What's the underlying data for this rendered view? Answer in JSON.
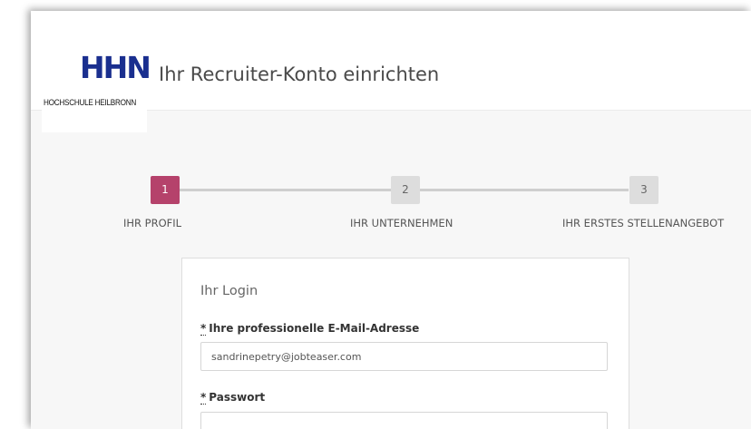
{
  "header": {
    "logo_mark": "HHN",
    "logo_text": "HOCHSCHULE HEILBRONN",
    "title": "Ihr Recruiter-Konto einrichten"
  },
  "stepper": {
    "steps": [
      {
        "number": "1",
        "label": "IHR PROFIL",
        "state": "active"
      },
      {
        "number": "2",
        "label": "IHR UNTERNEHMEN",
        "state": "inactive"
      },
      {
        "number": "3",
        "label": "IHR ERSTES STELLENANGEBOT",
        "state": "inactive"
      }
    ]
  },
  "form": {
    "section_title": "Ihr Login",
    "required_marker": "*",
    "email": {
      "label": "Ihre professionelle E-Mail-Adresse",
      "value": "sandrinepetry@jobteaser.com"
    },
    "password": {
      "label": "Passwort",
      "value": ""
    }
  },
  "colors": {
    "accent": "#b5426b",
    "logo_blue": "#1a2f8f",
    "inactive_step": "#dddddd",
    "background": "#f7f7f7"
  }
}
